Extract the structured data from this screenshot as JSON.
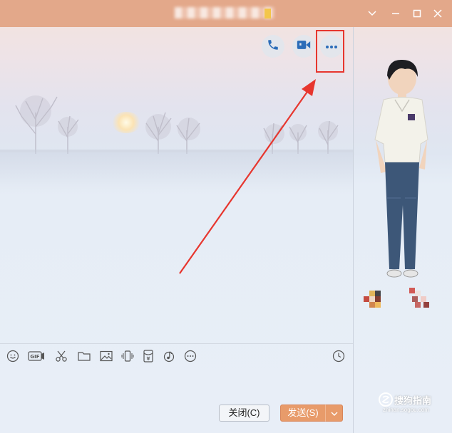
{
  "window": {
    "title": "",
    "minimize_icon": "minimize-icon",
    "maximize_icon": "maximize-icon",
    "close_icon": "close-icon",
    "dropdown_icon": "chevron-down-icon"
  },
  "header_actions": [
    {
      "name": "voice-call-button",
      "icon": "phone-icon"
    },
    {
      "name": "video-call-button",
      "icon": "video-camera-icon"
    },
    {
      "name": "more-options-button",
      "icon": "more-dots-icon"
    }
  ],
  "annotation": {
    "color": "#e7362e"
  },
  "toolbar": {
    "tools": [
      {
        "name": "emoji",
        "icon": "smiley-icon"
      },
      {
        "name": "gif",
        "icon": "gif-icon",
        "label": "GIF"
      },
      {
        "name": "screenshot",
        "icon": "scissors-icon"
      },
      {
        "name": "file",
        "icon": "folder-icon"
      },
      {
        "name": "image",
        "icon": "image-icon"
      },
      {
        "name": "shake",
        "icon": "vibrate-icon"
      },
      {
        "name": "red-packet",
        "icon": "red-packet-icon"
      },
      {
        "name": "music",
        "icon": "music-icon"
      },
      {
        "name": "more",
        "icon": "more-circle-icon"
      },
      {
        "name": "history",
        "icon": "clock-icon"
      }
    ]
  },
  "footer": {
    "close_label": "关闭(C)",
    "send_label": "发送(S)",
    "send_dropdown_icon": "chevron-down-icon"
  },
  "watermark": {
    "text": "搜狗指南",
    "url": "zhinan.sogou.com"
  },
  "colors": {
    "titlebar": "#e3a88a",
    "send_button": "#e89b6a",
    "icon_blue": "#2b6cb8"
  }
}
